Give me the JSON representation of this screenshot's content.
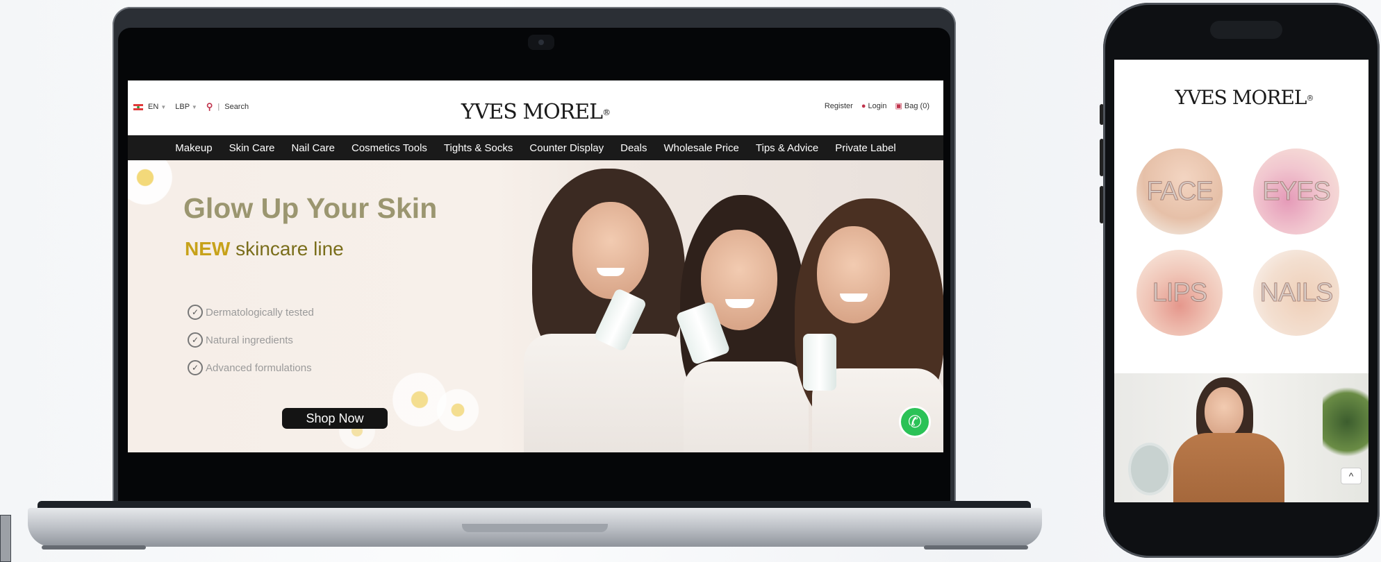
{
  "desktop": {
    "header": {
      "language": "EN",
      "currency": "LBP",
      "search_label": "Search",
      "logo": "YVES MOREL",
      "register": "Register",
      "login": "Login",
      "bag": "Bag (0)"
    },
    "nav": [
      "Makeup",
      "Skin Care",
      "Nail Care",
      "Cosmetics Tools",
      "Tights & Socks",
      "Counter Display",
      "Deals",
      "Wholesale Price",
      "Tips & Advice",
      "Private Label"
    ],
    "hero": {
      "title": "Glow Up Your Skin",
      "sub_new": "NEW",
      "sub_rest": "skincare line",
      "features": [
        "Dermatologically tested",
        "Natural ingredients",
        "Advanced formulations"
      ],
      "cta": "Shop Now"
    },
    "icons": {
      "whatsapp": "whatsapp-icon",
      "search": "search-icon",
      "login": "user-icon",
      "bag": "bag-icon"
    }
  },
  "mobile": {
    "logo": "YVES MOREL",
    "categories": [
      "FACE",
      "EYES",
      "LIPS",
      "NAILS"
    ],
    "scroll_top": "^"
  },
  "colors": {
    "accent": "#c0334c",
    "hero_title": "#9b9670",
    "hero_new": "#c7a21a",
    "nav_bg": "#1a1a1a",
    "whatsapp": "#2bc257"
  }
}
